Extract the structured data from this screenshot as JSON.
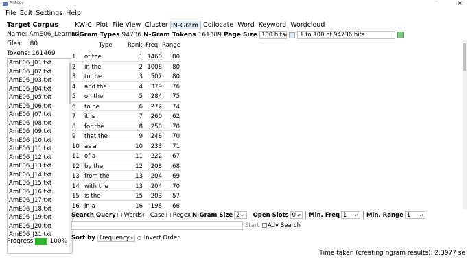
{
  "window": {
    "app_name": "Antcov",
    "minimize_glyph": "–",
    "close_glyph": "×"
  },
  "menu": [
    "File",
    "Edit",
    "Settings",
    "Help"
  ],
  "left": {
    "title": "Target Corpus",
    "name_label": "Name:",
    "name_value": "AmE06_Learned",
    "files_label": "Files:",
    "files_value": "80",
    "tokens_label": "Tokens:",
    "tokens_value": "161469",
    "files": [
      "AmE06_J01.txt",
      "AmE06_J02.txt",
      "AmE06_J03.txt",
      "AmE06_J04.txt",
      "AmE06_J05.txt",
      "AmE06_J06.txt",
      "AmE06_J07.txt",
      "AmE06_J08.txt",
      "AmE06_J09.txt",
      "AmE06_J10.txt",
      "AmE06_J11.txt",
      "AmE06_J12.txt",
      "AmE06_J13.txt",
      "AmE06_J14.txt",
      "AmE06_J15.txt",
      "AmE06_J16.txt",
      "AmE06_J17.txt",
      "AmE06_J18.txt",
      "AmE06_J19.txt",
      "AmE06_J20.txt",
      "AmE06_J21.txt"
    ],
    "progress_label": "Progress",
    "progress_value": "100%",
    "progress_fraction": 1.0
  },
  "tabs": [
    "KWIC",
    "Plot",
    "File View",
    "Cluster",
    "N-Gram",
    "Collocate",
    "Word",
    "Keyword",
    "Wordcloud"
  ],
  "active_tab": "N-Gram",
  "header": {
    "types_label": "N-Gram Types",
    "types_value": "94736",
    "tokens_label": "N-Gram Tokens",
    "tokens_value": "161389",
    "page_size_label": "Page Size",
    "page_size_value": "100 hits",
    "range_text": "1 to 100 of 94736 hits"
  },
  "table": {
    "columns": [
      "Type",
      "Rank",
      "Freq",
      "Range"
    ],
    "rows": [
      {
        "i": "1",
        "type": "of the",
        "rank": "1",
        "freq": "1460",
        "range": "80"
      },
      {
        "i": "2",
        "type": "in the",
        "rank": "2",
        "freq": "1008",
        "range": "80"
      },
      {
        "i": "3",
        "type": "to the",
        "rank": "3",
        "freq": "507",
        "range": "80"
      },
      {
        "i": "4",
        "type": "and the",
        "rank": "4",
        "freq": "379",
        "range": "76"
      },
      {
        "i": "5",
        "type": "on the",
        "rank": "5",
        "freq": "284",
        "range": "75"
      },
      {
        "i": "6",
        "type": "to be",
        "rank": "6",
        "freq": "272",
        "range": "74"
      },
      {
        "i": "7",
        "type": "it is",
        "rank": "7",
        "freq": "260",
        "range": "62"
      },
      {
        "i": "8",
        "type": "for the",
        "rank": "8",
        "freq": "250",
        "range": "70"
      },
      {
        "i": "9",
        "type": "that the",
        "rank": "9",
        "freq": "248",
        "range": "70"
      },
      {
        "i": "10",
        "type": "as a",
        "rank": "10",
        "freq": "233",
        "range": "71"
      },
      {
        "i": "11",
        "type": "of a",
        "rank": "11",
        "freq": "222",
        "range": "67"
      },
      {
        "i": "12",
        "type": "by the",
        "rank": "12",
        "freq": "208",
        "range": "68"
      },
      {
        "i": "13",
        "type": "from the",
        "rank": "13",
        "freq": "204",
        "range": "69"
      },
      {
        "i": "14",
        "type": "with the",
        "rank": "13",
        "freq": "204",
        "range": "70"
      },
      {
        "i": "15",
        "type": "is the",
        "rank": "15",
        "freq": "203",
        "range": "57"
      },
      {
        "i": "16",
        "type": "in a",
        "rank": "16",
        "freq": "198",
        "range": "66"
      }
    ]
  },
  "search": {
    "label": "Search Query",
    "words": "Words",
    "case": "Case",
    "regex": "Regex",
    "ngram_size_label": "N-Gram Size",
    "ngram_size_value": "2",
    "open_slots_label": "Open Slots",
    "open_slots_value": "0",
    "min_freq_label": "Min. Freq",
    "min_freq_value": "1",
    "min_range_label": "Min. Range",
    "min_range_value": "1",
    "start": "Start",
    "adv_search": "Adv Search"
  },
  "sort": {
    "label": "Sort by",
    "value": "Frequency",
    "invert": "Invert Order"
  },
  "status": "Time taken (creating ngram results): 2.3977 se"
}
